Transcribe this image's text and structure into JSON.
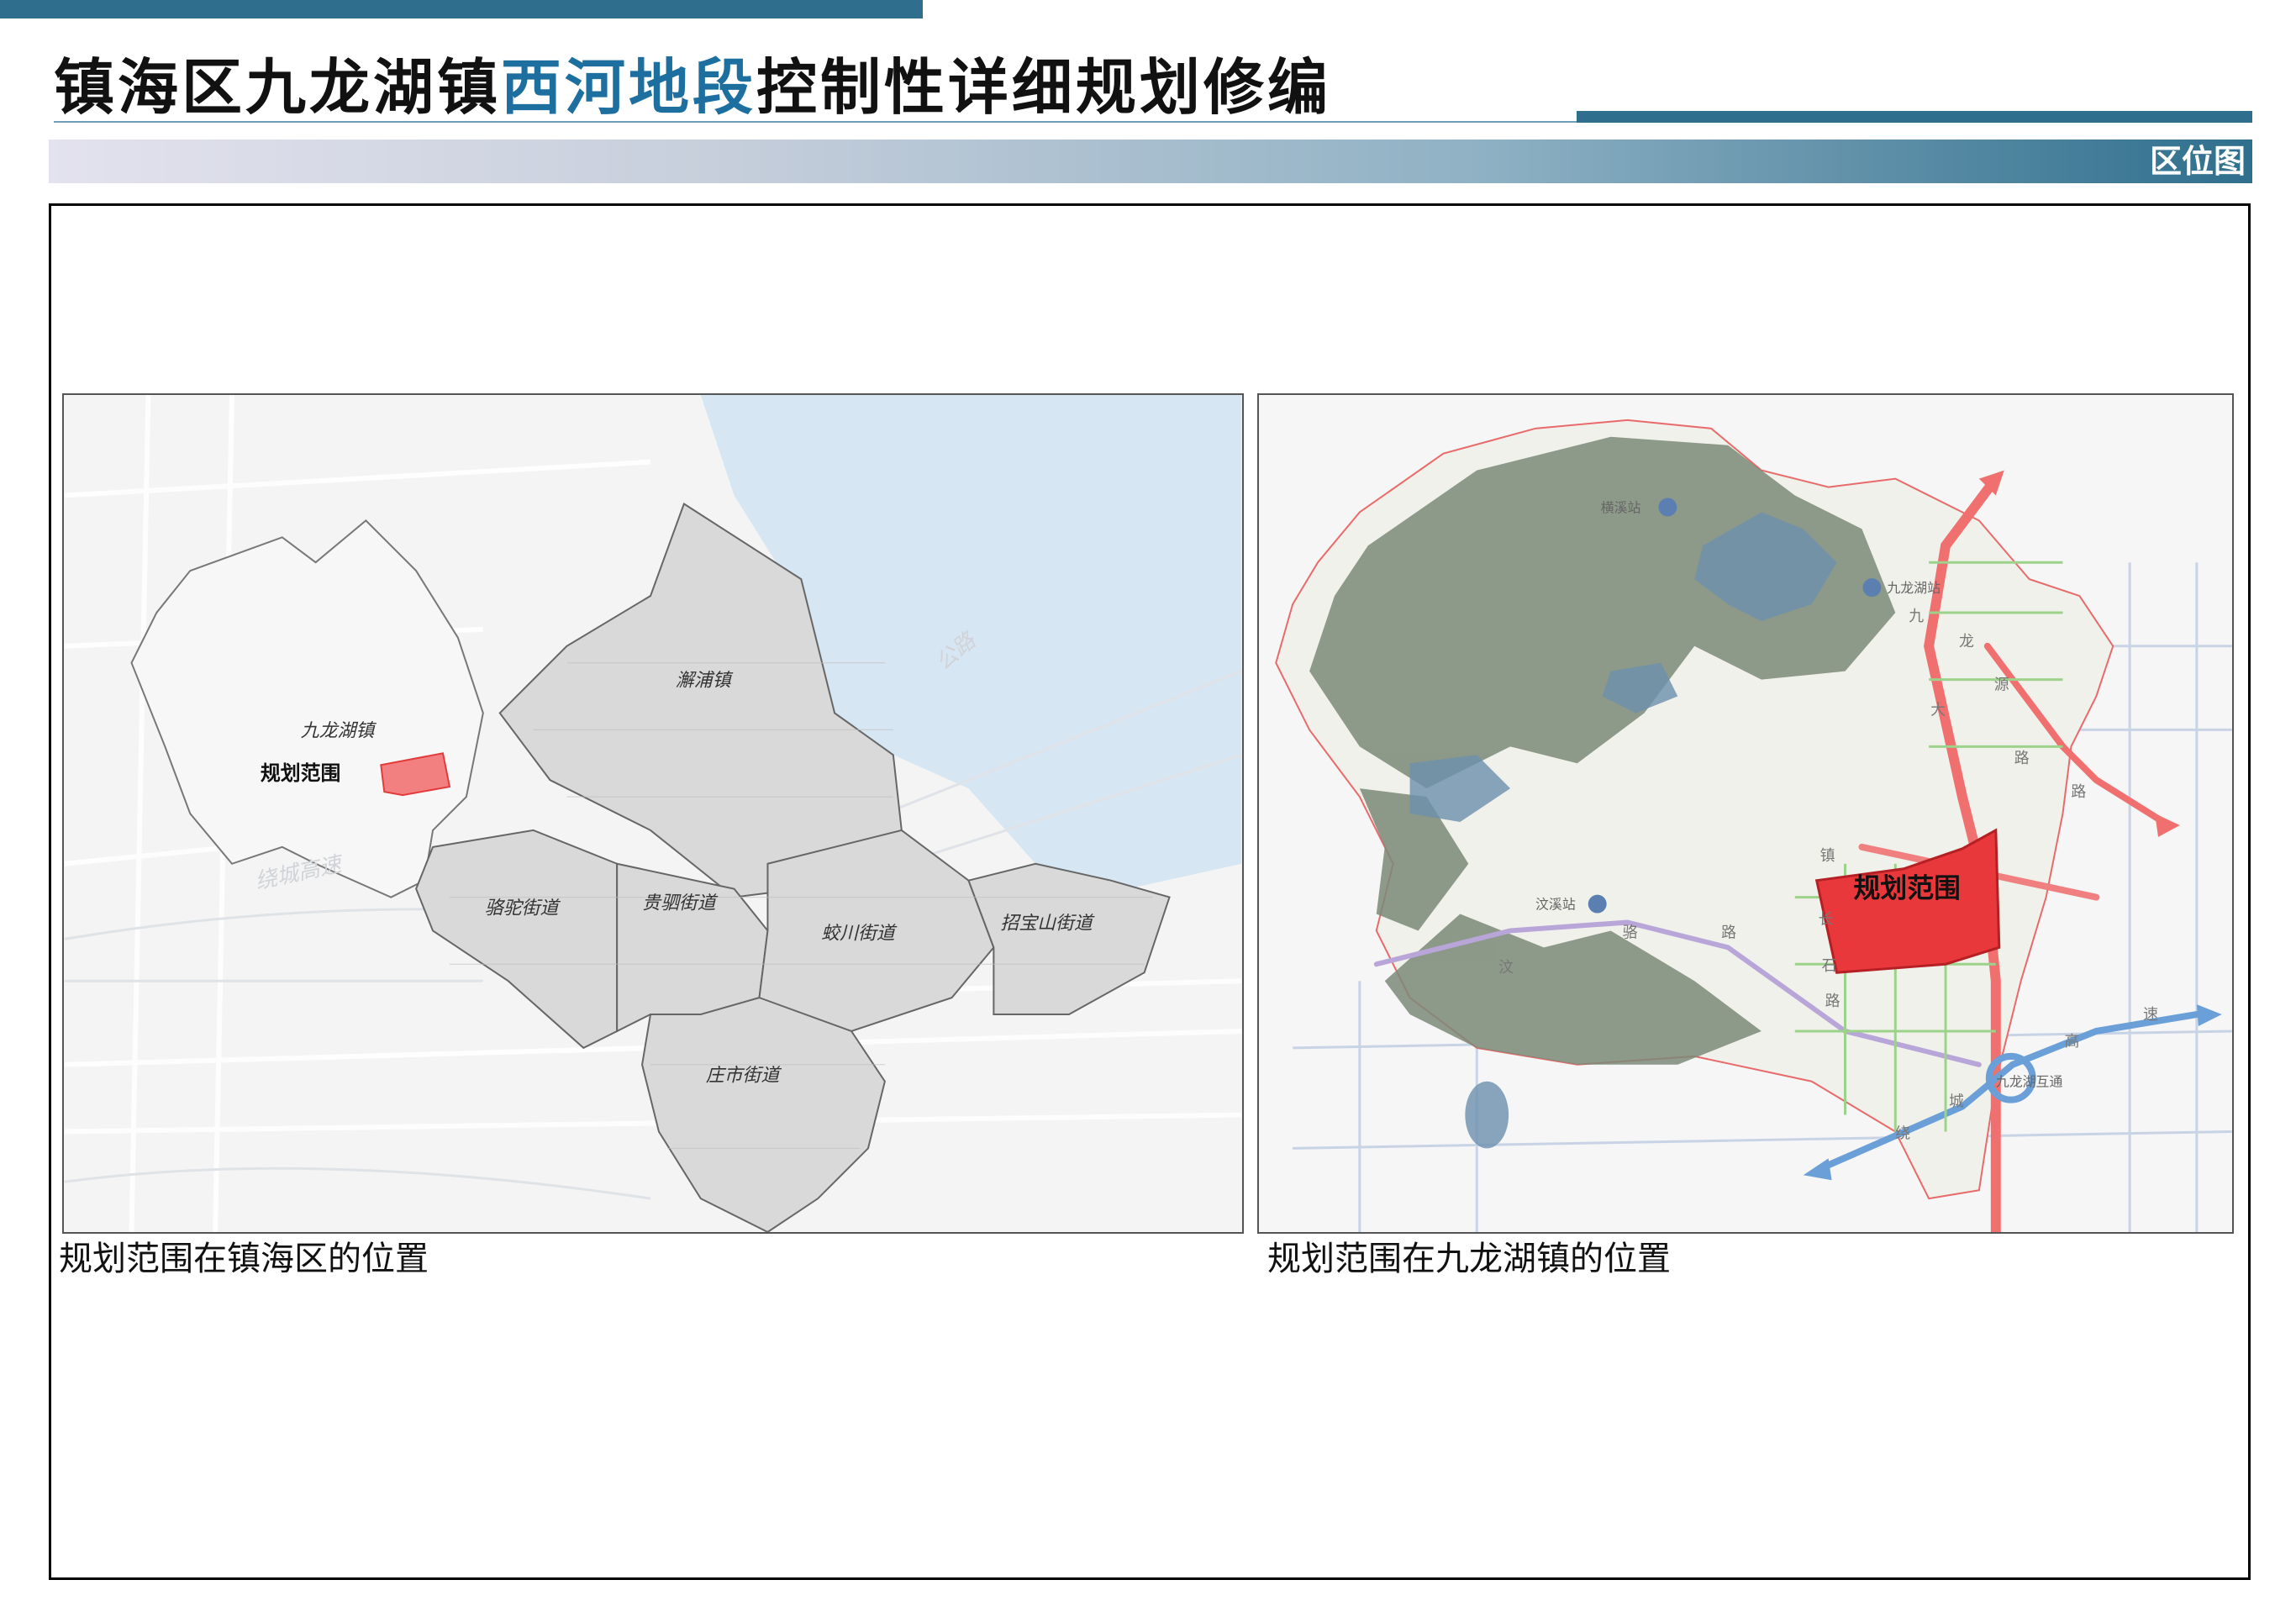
{
  "header": {
    "title_part1": "镇海区九龙湖镇",
    "title_highlight": "西河地段",
    "title_part2": "控制性详细规划修编",
    "section_label": "区位图"
  },
  "map_left": {
    "caption": "规划范围在镇海区的位置",
    "area_labels": {
      "jiulonghu": "九龙湖镇",
      "planning_area": "规划范围",
      "xiepu": "澥浦镇",
      "luotuo": "骆驼街道",
      "guisi": "贵驷街道",
      "jiaochuan": "蛟川街道",
      "zhaobaoshan": "招宝山街道",
      "zhuangshi": "庄市街道"
    },
    "road_labels": {
      "ring_highway": "绕城高速",
      "hangzhou_bay": "公路"
    }
  },
  "map_right": {
    "caption": "规划范围在九龙湖镇的位置",
    "area_labels": {
      "planning_area": "规划范围"
    },
    "station_labels": {
      "hengxi": "横溪站",
      "jiulonghu": "九龙湖站",
      "hanqi": "汶溪站",
      "interchange": "九龙湖互通"
    },
    "road_chars": {
      "jiulong_dadao": [
        "九",
        "龙",
        "大"
      ],
      "jiuyuan_lu": [
        "源",
        "路",
        "路"
      ],
      "zhenluo_lu": [
        "汶",
        "骆",
        "路"
      ],
      "zhenshi_lu": [
        "镇",
        "长",
        "石",
        "路"
      ],
      "ring": [
        "城",
        "绕"
      ],
      "expressway": [
        "速",
        "高"
      ]
    }
  },
  "colors": {
    "accent": "#2f6f8d",
    "highlight_title": "#1d6fa0",
    "planning_area": "#f04a4a",
    "district_fill": "#d9d9d9",
    "water": "#d6e6f2",
    "mountain": "#7b8a78",
    "road_red": "#f0686a",
    "expressway_blue": "#6a9fd8"
  }
}
